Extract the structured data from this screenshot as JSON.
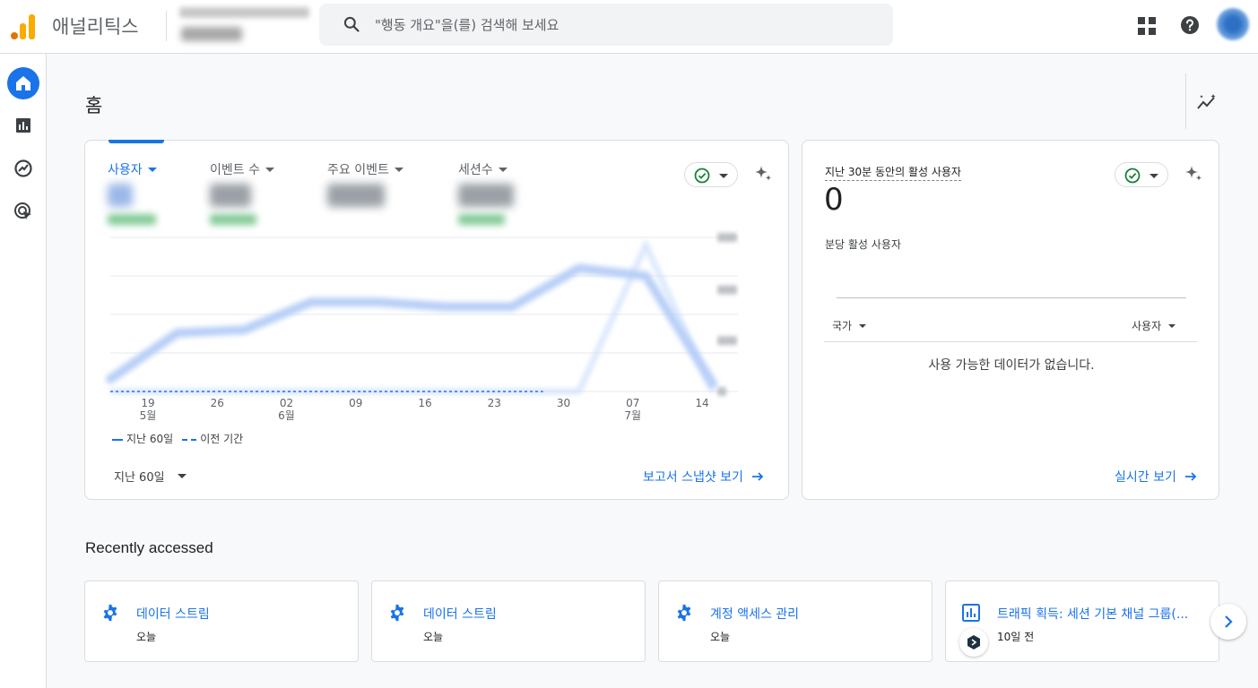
{
  "header": {
    "app_name": "애널리틱스",
    "search_placeholder": "\"행동 개요\"을(를) 검색해 보세요"
  },
  "page": {
    "title": "홈"
  },
  "overview_card": {
    "metrics": [
      {
        "label": "사용자",
        "active": true
      },
      {
        "label": "이벤트 수",
        "active": false
      },
      {
        "label": "주요 이벤트",
        "active": false
      },
      {
        "label": "세션수",
        "active": false
      }
    ],
    "legend": {
      "current": "지난 60일",
      "previous": "이전 기간"
    },
    "date_range": "지난 60일",
    "link": "보고서 스냅샷 보기"
  },
  "chart_data": {
    "type": "line",
    "x_ticks": [
      {
        "day": "19",
        "month": "5월"
      },
      {
        "day": "26",
        "month": ""
      },
      {
        "day": "02",
        "month": "6월"
      },
      {
        "day": "09",
        "month": ""
      },
      {
        "day": "16",
        "month": ""
      },
      {
        "day": "23",
        "month": ""
      },
      {
        "day": "30",
        "month": ""
      },
      {
        "day": "07",
        "month": "7월"
      },
      {
        "day": "14",
        "month": ""
      }
    ],
    "series": [
      {
        "name": "지난 60일",
        "values": [
          0.08,
          0.38,
          0.4,
          0.58,
          0.58,
          0.55,
          0.55,
          0.8,
          0.75,
          0.05
        ]
      },
      {
        "name": "이전 기간",
        "values": [
          0,
          0,
          0,
          0,
          0,
          0,
          0,
          0,
          0.95,
          0
        ]
      }
    ],
    "ylim": [
      0,
      1
    ],
    "grid": true
  },
  "realtime_card": {
    "title": "지난 30분 동안의 활성 사용자",
    "value": "0",
    "subtitle": "분당 활성 사용자",
    "col_country": "국가",
    "col_users": "사용자",
    "empty_message": "사용 가능한 데이터가 없습니다.",
    "link": "실시간 보기"
  },
  "recent": {
    "title": "Recently accessed",
    "items": [
      {
        "label": "데이터 스트림",
        "time": "오늘",
        "icon": "gear-icon"
      },
      {
        "label": "데이터 스트림",
        "time": "오늘",
        "icon": "gear-icon"
      },
      {
        "label": "계정 액세스 관리",
        "time": "오늘",
        "icon": "gear-icon"
      },
      {
        "label": "트래픽 획득: 세션 기본 채널 그룹(...",
        "time": "10일 전",
        "icon": "report-icon"
      }
    ]
  },
  "colors": {
    "accent": "#1a73e8",
    "nav_active": "#1a73e8",
    "success": "#188038"
  }
}
